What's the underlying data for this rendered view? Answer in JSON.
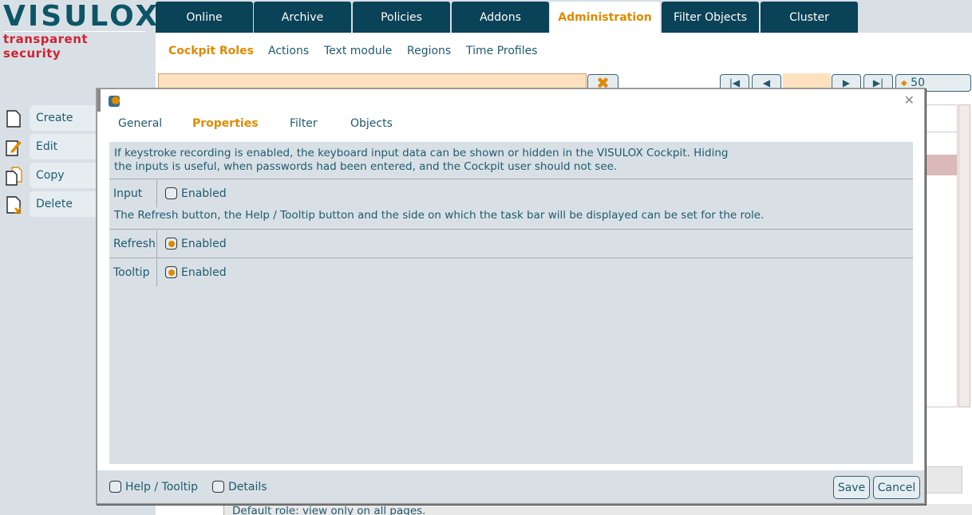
{
  "logo": {
    "name": "VISULOX",
    "tagline": "transparent security"
  },
  "nav": {
    "tabs": [
      {
        "label": "Online"
      },
      {
        "label": "Archive"
      },
      {
        "label": "Policies"
      },
      {
        "label": "Addons"
      },
      {
        "label": "Administration",
        "active": true
      },
      {
        "label": "Filter Objects"
      },
      {
        "label": "Cluster"
      }
    ]
  },
  "subnav": {
    "items": [
      {
        "label": "Cockpit Roles",
        "active": true
      },
      {
        "label": "Actions"
      },
      {
        "label": "Text module"
      },
      {
        "label": "Regions"
      },
      {
        "label": "Time Profiles"
      }
    ]
  },
  "search": {
    "value": ""
  },
  "pager": {
    "page_size": "50",
    "page_value": ""
  },
  "sidebar": {
    "items": [
      {
        "label": "Create",
        "icon": "page-icon"
      },
      {
        "label": "Edit",
        "icon": "edit-icon"
      },
      {
        "label": "Copy",
        "icon": "copy-icon"
      },
      {
        "label": "Delete",
        "icon": "delete-icon"
      }
    ]
  },
  "background": {
    "status_text": "Default role: view only on all pages."
  },
  "dialog": {
    "tabs": [
      {
        "label": "General"
      },
      {
        "label": "Properties",
        "active": true
      },
      {
        "label": "Filter"
      },
      {
        "label": "Objects"
      }
    ],
    "desc1": "If keystroke recording is enabled, the keyboard input data can be shown or hidden in the VISULOX Cockpit. Hiding the inputs is useful, when passwords had been entered, and the Cockpit user should not see.",
    "desc2": "The Refresh button, the Help / Tooltip button and the side on which the task bar will be displayed can be set for the role.",
    "rows": [
      {
        "label": "Input",
        "option": "Enabled",
        "checked": false
      },
      {
        "label": "Refresh",
        "option": "Enabled",
        "checked": true
      },
      {
        "label": "Tooltip",
        "option": "Enabled",
        "checked": true
      }
    ],
    "footer": {
      "help": "Help / Tooltip",
      "details": "Details",
      "save": "Save",
      "cancel": "Cancel"
    }
  },
  "colors": {
    "accent": "#e08a00",
    "nav": "#0a4257",
    "text": "#1f5a6e",
    "panel": "#d8e0e6"
  }
}
